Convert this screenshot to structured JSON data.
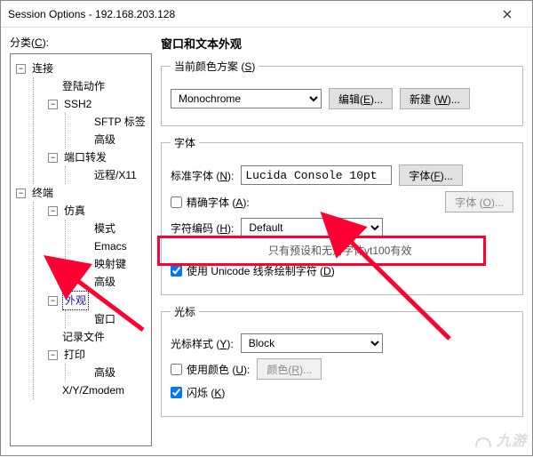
{
  "title": "Session Options - 192.168.203.128",
  "category_label": "分类",
  "category_key": "C",
  "tree": {
    "conn": "连接",
    "login": "登陆动作",
    "ssh2": "SSH2",
    "sftp": "SFTP 标签",
    "adv1": "高级",
    "portfwd": "端口转发",
    "remote": "远程/X11",
    "term": "终端",
    "emul": "仿真",
    "mode": "模式",
    "emacs": "Emacs",
    "mapkey": "映射键",
    "adv2": "高级",
    "appearance": "外观",
    "window": "窗口",
    "logfile": "记录文件",
    "print": "打印",
    "adv3": "高级",
    "xyz": "X/Y/Zmodem"
  },
  "right": {
    "heading": "窗口和文本外观",
    "scheme_group": "当前颜色方案",
    "scheme_key": "S",
    "scheme_value": "Monochrome",
    "edit_btn": "编辑",
    "edit_key": "E",
    "new_btn": "新建",
    "new_key": "W",
    "font_group": "字体",
    "std_font_label": "标准字体",
    "std_font_key": "N",
    "font_value": "Lucida Console 10pt",
    "font_btn": "字体",
    "font_btn_key": "F",
    "exact_font": "精确字体",
    "exact_font_key": "A",
    "font_btn2": "字体",
    "font_btn2_key": "O",
    "charset_label": "字符编码",
    "charset_key": "H",
    "charset_value": "Default",
    "charset_note": "只有预设和无对字体vt100有效",
    "unicode_draw": "使用 Unicode 线条绘制字符",
    "unicode_draw_key": "D",
    "cursor_group": "光标",
    "cursor_style": "光标样式",
    "cursor_key": "Y",
    "cursor_value": "Block",
    "use_color": "使用颜色",
    "use_color_key": "U",
    "color_btn": "颜色",
    "color_key": "R",
    "blink": "闪烁",
    "blink_key": "K"
  },
  "watermark": "九游"
}
